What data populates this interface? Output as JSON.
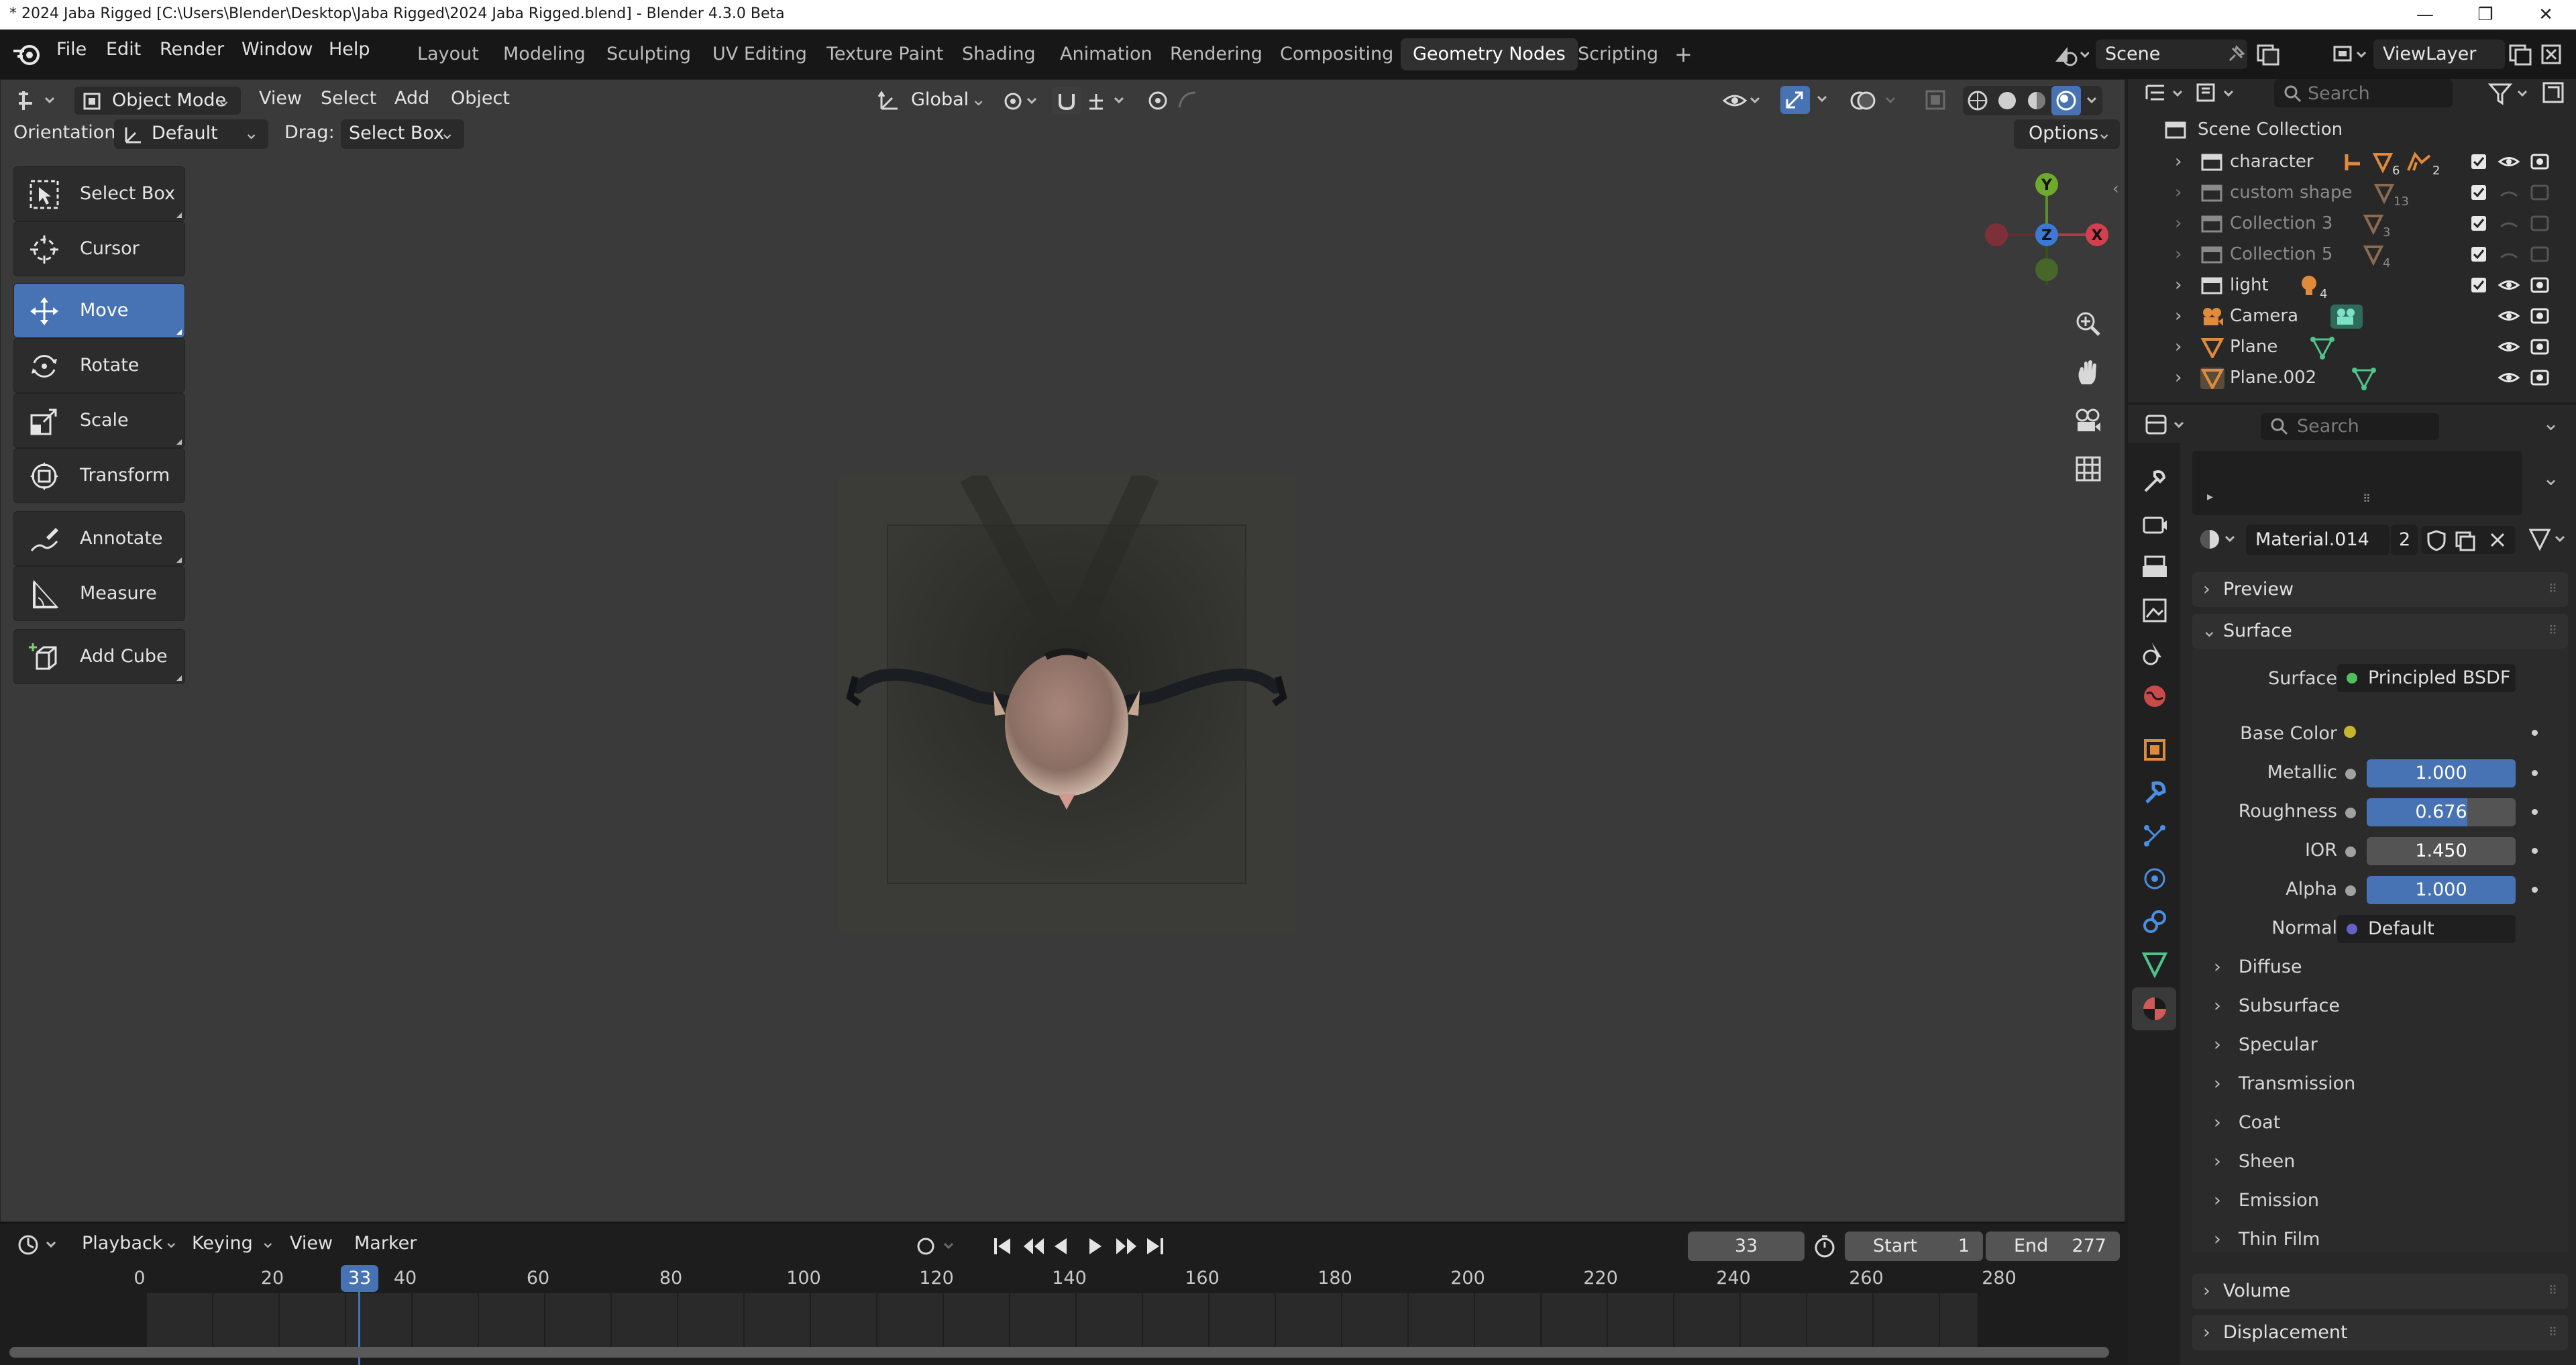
{
  "titlebar": {
    "title": "* 2024 Jaba Rigged [C:\\Users\\Blender\\Desktop\\Jaba Rigged\\2024 Jaba Rigged.blend] - Blender 4.3.0 Beta",
    "minimize": "—",
    "restore": "❐",
    "close": "✕"
  },
  "menu": [
    "File",
    "Edit",
    "Render",
    "Window",
    "Help"
  ],
  "workspaces": [
    "Layout",
    "Modeling",
    "Sculpting",
    "UV Editing",
    "Texture Paint",
    "Shading",
    "Animation",
    "Rendering",
    "Compositing",
    "Geometry Nodes",
    "Scripting"
  ],
  "active_workspace": "Geometry Nodes",
  "add_tab": "+",
  "scene": {
    "scene_name": "Scene",
    "view_layer": "ViewLayer"
  },
  "viewport_header": {
    "mode": "Object Mode",
    "view": "View",
    "select": "Select",
    "add": "Add",
    "object": "Object",
    "transform_orientation": "Global",
    "orientation_label": "Orientation:",
    "orientation_value": "Default",
    "drag_label": "Drag:",
    "drag_value": "Select Box",
    "options": "Options"
  },
  "tools": [
    {
      "label": "Select Box",
      "icon": "select-box-icon"
    },
    {
      "label": "Cursor",
      "icon": "cursor-icon"
    },
    {
      "label": "Move",
      "icon": "move-icon",
      "active": true
    },
    {
      "label": "Rotate",
      "icon": "rotate-icon"
    },
    {
      "label": "Scale",
      "icon": "scale-icon"
    },
    {
      "label": "Transform",
      "icon": "transform-icon"
    },
    {
      "label": "Annotate",
      "icon": "annotate-icon"
    },
    {
      "label": "Measure",
      "icon": "measure-icon"
    },
    {
      "label": "Add Cube",
      "icon": "add-cube-icon"
    }
  ],
  "gizmo": {
    "y": "Y",
    "z": "Z",
    "x": "X"
  },
  "timeline": {
    "playback": "Playback",
    "keying": "Keying",
    "view": "View",
    "marker": "Marker",
    "current_frame": "33",
    "start_label": "Start",
    "start_value": "1",
    "end_label": "End",
    "end_value": "277",
    "ruler": [
      "0",
      "20",
      "40",
      "60",
      "80",
      "100",
      "120",
      "140",
      "160",
      "180",
      "200",
      "220",
      "240",
      "260",
      "280"
    ],
    "playhead": "33"
  },
  "outliner": {
    "search_placeholder": "Search",
    "root": "Scene Collection",
    "items": [
      {
        "label": "character",
        "dim": false,
        "badge1": "6",
        "badge2": "2"
      },
      {
        "label": "custom shape",
        "dim": true,
        "badge1": "13"
      },
      {
        "label": "Collection 3",
        "dim": true,
        "badge1": "3"
      },
      {
        "label": "Collection 5",
        "dim": true,
        "badge1": "4"
      },
      {
        "label": "light",
        "dim": false,
        "badge1": "4"
      },
      {
        "label": "Camera",
        "dim": false
      },
      {
        "label": "Plane",
        "dim": false
      },
      {
        "label": "Plane.002",
        "dim": false
      }
    ]
  },
  "properties": {
    "search_placeholder": "Search",
    "material_name": "Material.014",
    "user_count": "2",
    "preview": "Preview",
    "surface_panel": "Surface",
    "surface_label": "Surface",
    "surface_value": "Principled BSDF",
    "base_color_label": "Base Color",
    "base_color": "#c9b52c",
    "metallic_label": "Metallic",
    "metallic": "1.000",
    "roughness_label": "Roughness",
    "roughness": "0.676",
    "ior_label": "IOR",
    "ior": "1.450",
    "alpha_label": "Alpha",
    "alpha": "1.000",
    "normal_label": "Normal",
    "normal": "Default",
    "subpanels": [
      "Diffuse",
      "Subsurface",
      "Specular",
      "Transmission",
      "Coat",
      "Sheen",
      "Emission",
      "Thin Film"
    ],
    "volume": "Volume",
    "displacement": "Displacement"
  }
}
